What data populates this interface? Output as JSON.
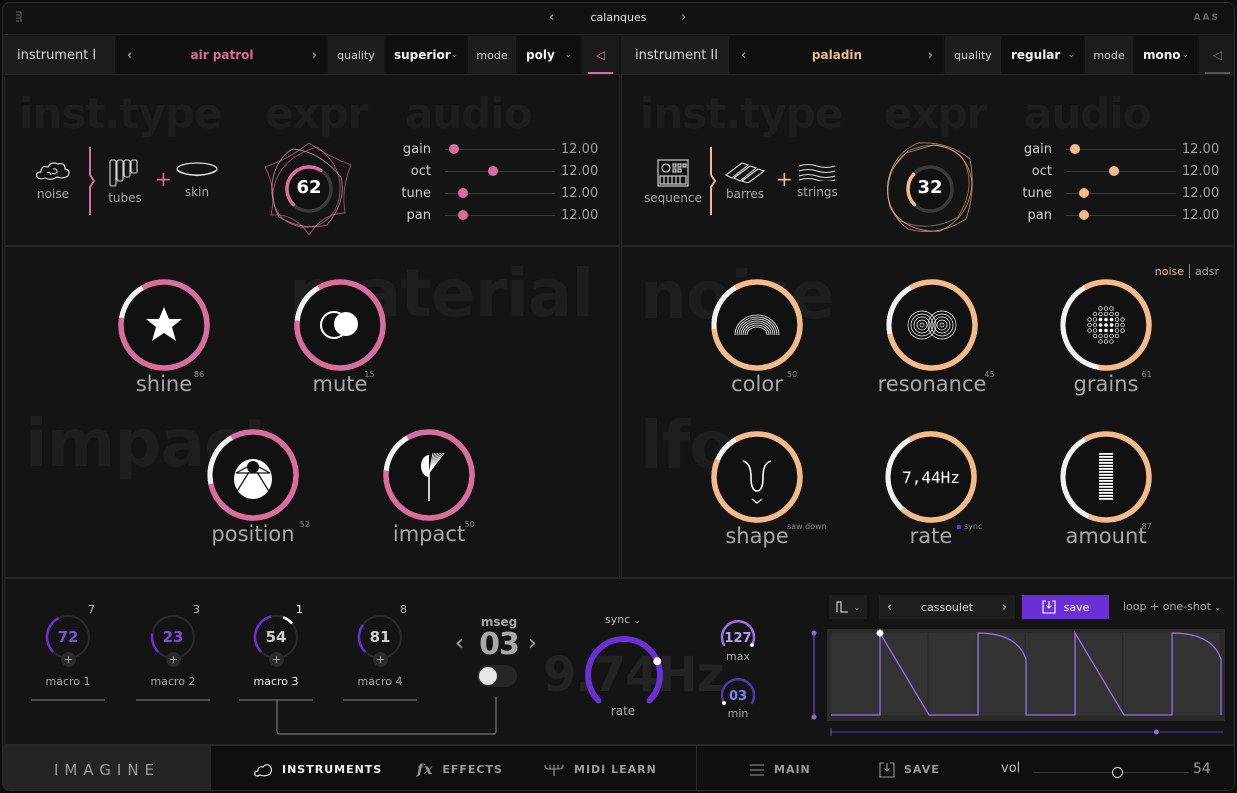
{
  "app": {
    "global_preset": "calanques",
    "vendor_logo": "AAS",
    "brand": "IMAGINE"
  },
  "colors": {
    "pink": "#d86f9a",
    "peach": "#f2bb8c",
    "purple": "#6b2fd6",
    "purple_light": "#9a72e6",
    "white": "#f5f5f5"
  },
  "instrument1": {
    "name": "instrument I",
    "preset": "air patrol",
    "quality_label": "quality",
    "quality_value": "superior",
    "mode_label": "mode",
    "mode_value": "poly",
    "section_titles": {
      "type": "inst.type",
      "expr": "expr",
      "audio": "audio"
    },
    "types": [
      {
        "icon": "cloud-icon",
        "label": "noise"
      },
      {
        "icon": "tubes-icon",
        "label": "tubes"
      },
      {
        "icon": "skin-icon",
        "label": "skin"
      }
    ],
    "expr_value": "62",
    "expr_fraction": 0.62,
    "audio": [
      {
        "label": "gain",
        "value": "12.00",
        "pos": 0.08
      },
      {
        "label": "oct",
        "value": "12.00",
        "pos": 0.44
      },
      {
        "label": "tune",
        "value": "12.00",
        "pos": 0.16
      },
      {
        "label": "pan",
        "value": "12.00",
        "pos": 0.16
      }
    ]
  },
  "instrument2": {
    "name": "instrument II",
    "preset": "paladin",
    "quality_label": "quality",
    "quality_value": "regular",
    "mode_label": "mode",
    "mode_value": "mono",
    "section_titles": {
      "type": "inst.type",
      "expr": "expr",
      "audio": "audio"
    },
    "types": [
      {
        "icon": "sequencer-icon",
        "label": "sequence"
      },
      {
        "icon": "barres-icon",
        "label": "barres"
      },
      {
        "icon": "strings-icon",
        "label": "strings"
      }
    ],
    "expr_value": "32",
    "expr_fraction": 0.32,
    "audio": [
      {
        "label": "gain",
        "value": "12.00",
        "pos": 0.08
      },
      {
        "label": "oct",
        "value": "12.00",
        "pos": 0.44
      },
      {
        "label": "tune",
        "value": "12.00",
        "pos": 0.16
      },
      {
        "label": "pan",
        "value": "12.00",
        "pos": 0.16
      }
    ]
  },
  "material_panel": {
    "ghost_title_1": "material",
    "ghost_title_2": "impact",
    "knobs": [
      {
        "label": "shine",
        "value": "86",
        "fraction": 0.86,
        "icon": "star-icon"
      },
      {
        "label": "mute",
        "value": "15",
        "fraction": 0.85,
        "icon": "mute-circles-icon"
      },
      {
        "label": "position",
        "value": "52",
        "fraction": 0.8,
        "icon": "position-drum-icon"
      },
      {
        "label": "impact",
        "value": "50",
        "fraction": 0.85,
        "icon": "mallet-icon"
      }
    ]
  },
  "noise_panel": {
    "ghost_title_1": "noise",
    "ghost_title_2": "lfo",
    "toggle_active": "noise",
    "toggle_inactive": "adsr",
    "knobs": [
      {
        "label": "color",
        "value": "50",
        "fraction": 0.82,
        "icon": "rainbow-arcs-icon"
      },
      {
        "label": "resonance",
        "value": "45",
        "fraction": 0.8,
        "icon": "concentric-circles-icon"
      },
      {
        "label": "grains",
        "value": "61",
        "fraction": 0.61,
        "icon": "dot-grid-icon"
      },
      {
        "label": "shape",
        "value": "saw down",
        "fraction": 0.9,
        "icon": "lfo-shape-icon"
      },
      {
        "label": "rate",
        "value": "7,44Hz",
        "sub": "sync",
        "fraction": 0.7,
        "icon": "rate-readout"
      },
      {
        "label": "amount",
        "value": "87",
        "fraction": 0.65,
        "icon": "bars-icon"
      }
    ]
  },
  "macros": [
    {
      "label": "macro 1",
      "value": "72",
      "count": "7",
      "fraction": 0.4,
      "active": false
    },
    {
      "label": "macro 2",
      "value": "23",
      "count": "3",
      "fraction": 0.2,
      "active": false
    },
    {
      "label": "macro 3",
      "value": "54",
      "count": "1",
      "fraction": 0.45,
      "active": true
    },
    {
      "label": "macro 4",
      "value": "81",
      "count": "8",
      "fraction": 0.3,
      "active": false
    }
  ],
  "mseg": {
    "label": "mseg",
    "number": "03",
    "toggle_on": false,
    "sync_label": "sync",
    "rate_label": "rate",
    "rate_ghost": "9.74Hz",
    "rate_fraction": 0.75,
    "max_value": "127",
    "max_label": "max",
    "min_value": "03",
    "min_label": "min",
    "preset": "cassoulet",
    "save_label": "save",
    "loop_mode": "loop + one-shot",
    "scroll_fraction": 0.83
  },
  "footer": {
    "tabs": [
      {
        "label": "INSTRUMENTS",
        "icon": "instruments-icon",
        "active": true
      },
      {
        "label": "EFFECTS",
        "icon": "fx-icon",
        "active": false
      },
      {
        "label": "MIDI LEARN",
        "icon": "midi-learn-icon",
        "active": false
      }
    ],
    "main_label": "MAIN",
    "save_label": "SAVE",
    "vol_label": "vol",
    "vol_value": "54",
    "vol_fraction": 0.54
  }
}
